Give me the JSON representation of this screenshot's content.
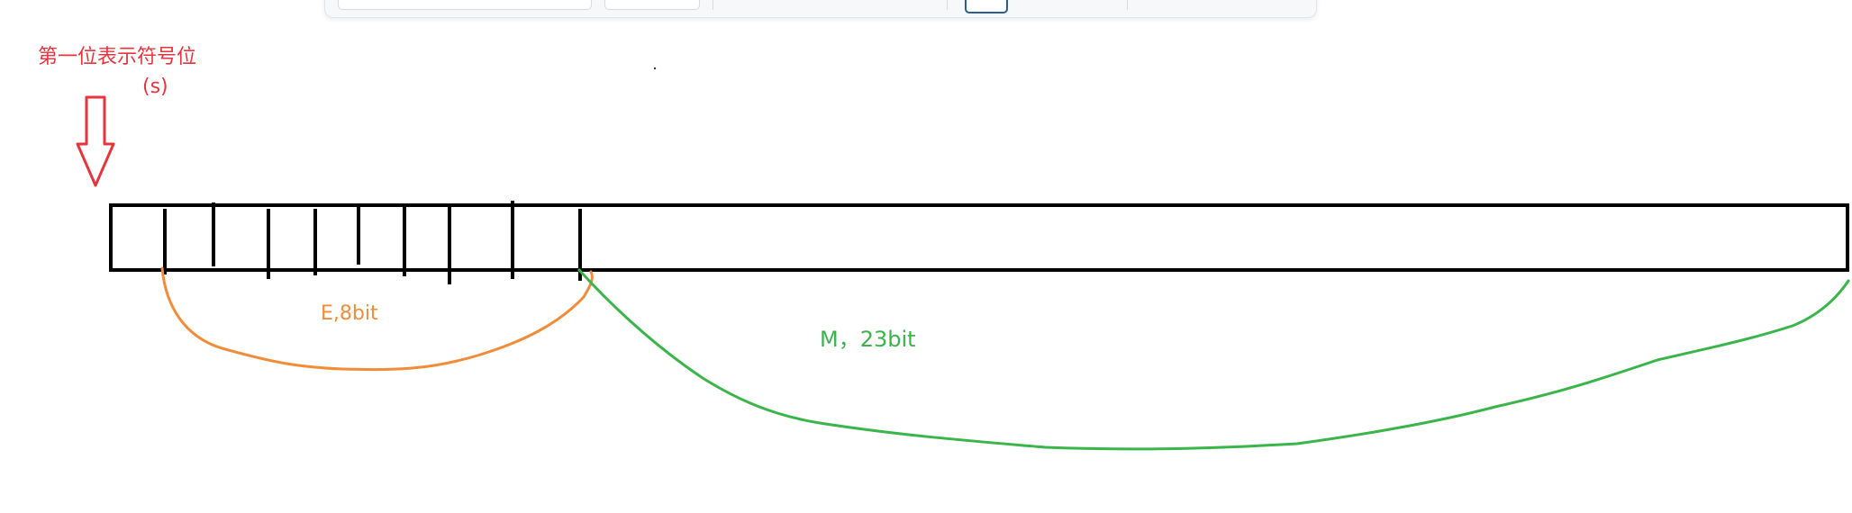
{
  "labels": {
    "sign_bit": "第一位表示符号位",
    "sign_symbol": "(s)",
    "exponent": "E,8bit",
    "mantissa": "M，23bit"
  },
  "colors": {
    "sign": "#e8343c",
    "exponent": "#f28c38",
    "mantissa": "#39b54a",
    "outline": "#000000"
  }
}
